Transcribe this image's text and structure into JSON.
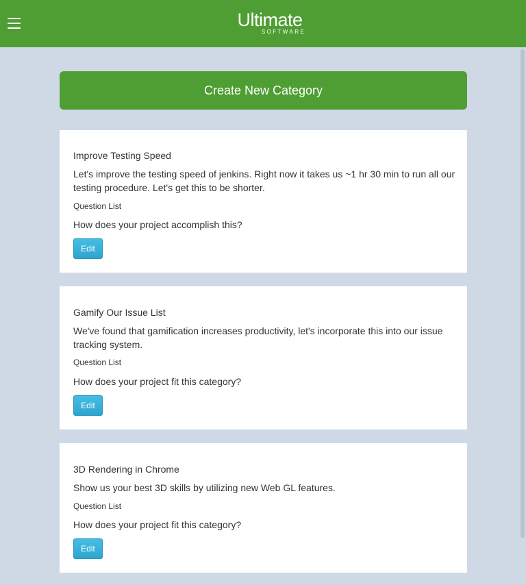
{
  "header": {
    "menu_icon": "hamburger-menu-icon",
    "logo_main": "Ultimate",
    "logo_sub": "SOFTWARE",
    "brand_color": "#4f9e33"
  },
  "actions": {
    "create_label": "Create New Category"
  },
  "categories": [
    {
      "title": "Improve Testing Speed",
      "description": "Let's improve the testing speed of jenkins. Right now it takes us ~1 hr 30 min to run all our testing procedure. Let's get this to be shorter.",
      "question_list_label": "Question List",
      "question": "How does your project accomplish this?",
      "edit_label": "Edit"
    },
    {
      "title": "Gamify Our Issue List",
      "description": "We've found that gamification increases productivity, let's incorporate this into our issue tracking system.",
      "question_list_label": "Question List",
      "question": "How does your project fit this category?",
      "edit_label": "Edit"
    },
    {
      "title": "3D Rendering in Chrome",
      "description": "Show us your best 3D skills by utilizing new Web GL features.",
      "question_list_label": "Question List",
      "question": "How does your project fit this category?",
      "edit_label": "Edit"
    }
  ],
  "colors": {
    "background": "#cfd9e6",
    "edit_button": "#3ab0d8"
  }
}
